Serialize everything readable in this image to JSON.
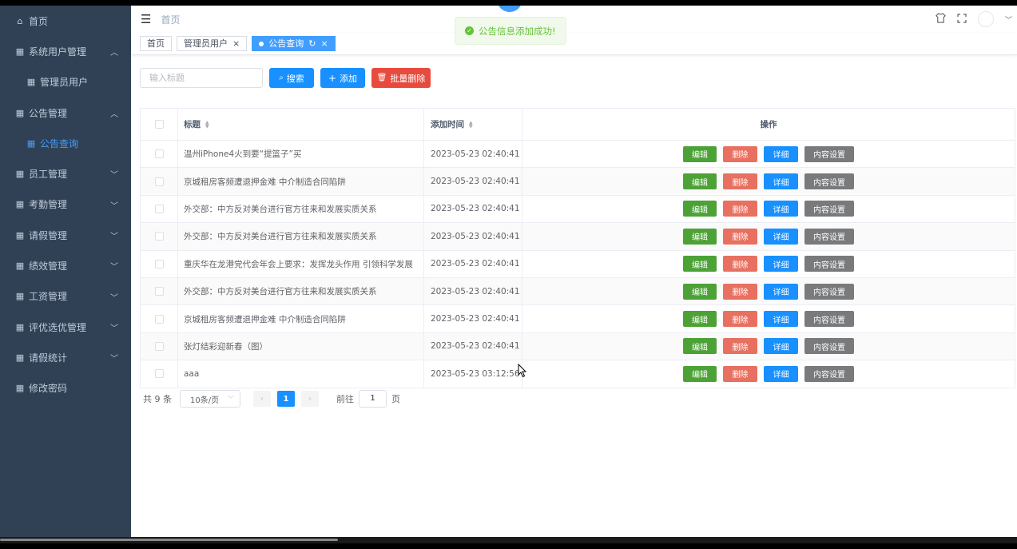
{
  "sidebar": {
    "items": [
      {
        "label": "首页",
        "icon": "home-icon",
        "arrow": ""
      },
      {
        "label": "系统用户管理",
        "icon": "grid-icon",
        "arrow": "up"
      },
      {
        "label": "管理员用户",
        "icon": "apps-icon",
        "arrow": "",
        "sub": true
      },
      {
        "label": "公告管理",
        "icon": "grid-icon",
        "arrow": "up"
      },
      {
        "label": "公告查询",
        "icon": "apps-icon",
        "arrow": "",
        "sub": true,
        "active": true
      },
      {
        "label": "员工管理",
        "icon": "grid-icon",
        "arrow": "down"
      },
      {
        "label": "考勤管理",
        "icon": "grid-icon",
        "arrow": "down"
      },
      {
        "label": "请假管理",
        "icon": "grid-icon",
        "arrow": "down"
      },
      {
        "label": "绩效管理",
        "icon": "grid-icon",
        "arrow": "down"
      },
      {
        "label": "工资管理",
        "icon": "grid-icon",
        "arrow": "down"
      },
      {
        "label": "评优选优管理",
        "icon": "grid-icon",
        "arrow": "down"
      },
      {
        "label": "请假统计",
        "icon": "grid-icon",
        "arrow": "down"
      },
      {
        "label": "修改密码",
        "icon": "grid-icon",
        "arrow": ""
      }
    ]
  },
  "header": {
    "breadcrumb": "首页"
  },
  "tags": [
    {
      "label": "首页",
      "closable": false,
      "active": false
    },
    {
      "label": "管理员用户",
      "closable": true,
      "active": false
    },
    {
      "label": "公告查询",
      "closable": true,
      "active": true
    }
  ],
  "toast": {
    "message": "公告信息添加成功!"
  },
  "toolbar": {
    "search_placeholder": "输入标题",
    "search_label": "搜索",
    "add_label": "添加",
    "batch_delete_label": "批量删除"
  },
  "table": {
    "columns": {
      "title": "标题",
      "time": "添加时间",
      "ops": "操作"
    },
    "op_labels": {
      "edit": "编辑",
      "delete": "删除",
      "detail": "详细",
      "content": "内容设置"
    },
    "rows": [
      {
        "title": "温州iPhone4火到要“提篮子”买",
        "time": "2023-05-23 02:40:41"
      },
      {
        "title": "京城租房客频遭退押金难 中介制造合同陷阱",
        "time": "2023-05-23 02:40:41"
      },
      {
        "title": "外交部：中方反对美台进行官方往来和发展实质关系",
        "time": "2023-05-23 02:40:41"
      },
      {
        "title": "外交部：中方反对美台进行官方往来和发展实质关系",
        "time": "2023-05-23 02:40:41"
      },
      {
        "title": "重庆华在龙港党代会年会上要求：发挥龙头作用 引领科学发展",
        "time": "2023-05-23 02:40:41"
      },
      {
        "title": "外交部：中方反对美台进行官方往来和发展实质关系",
        "time": "2023-05-23 02:40:41"
      },
      {
        "title": "京城租房客频遭退押金难 中介制造合同陷阱",
        "time": "2023-05-23 02:40:41"
      },
      {
        "title": "张灯结彩迎新春（图）",
        "time": "2023-05-23 02:40:41"
      },
      {
        "title": "aaa",
        "time": "2023-05-23 03:12:56"
      }
    ]
  },
  "pagination": {
    "total": "共 9 条",
    "page_size": "10条/页",
    "current_page": "1",
    "goto_label": "前往",
    "goto_value": "1",
    "page_unit": "页"
  },
  "colors": {
    "sidebar_bg": "#304156",
    "primary": "#1890ff",
    "danger": "#e84b3e",
    "success": "#4ca236"
  }
}
